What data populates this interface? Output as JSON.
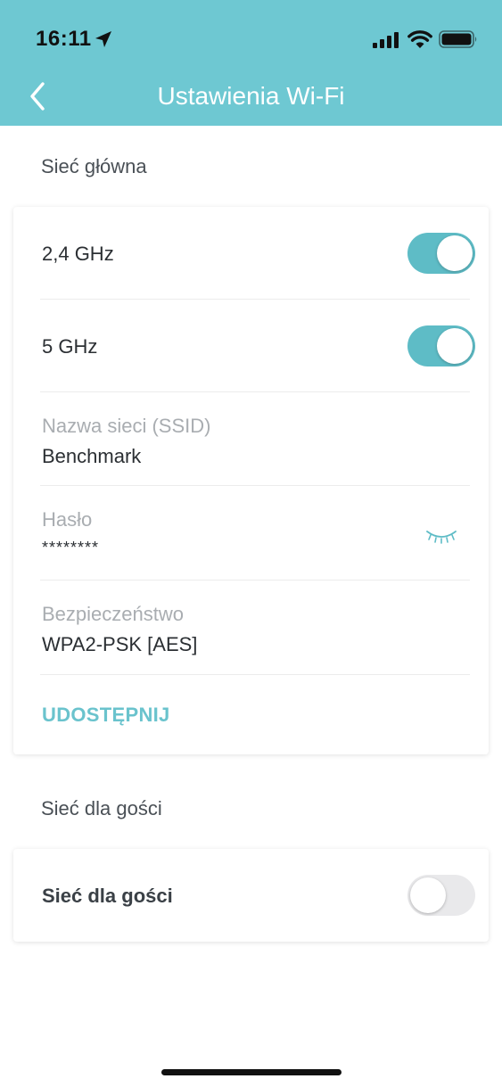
{
  "status_bar": {
    "time": "16:11"
  },
  "nav": {
    "title": "Ustawienia Wi-Fi",
    "back_icon": "chevron-left-icon"
  },
  "main_network": {
    "section_label": "Sieć główna",
    "band_24": {
      "label": "2,4 GHz",
      "enabled": true
    },
    "band_5": {
      "label": "5 GHz",
      "enabled": true
    },
    "ssid": {
      "caption": "Nazwa sieci (SSID)",
      "value": "Benchmark"
    },
    "password": {
      "caption": "Hasło",
      "value": "********",
      "reveal_icon": "eye-closed-icon"
    },
    "security": {
      "caption": "Bezpieczeństwo",
      "value": "WPA2-PSK [AES]"
    },
    "share_label": "UDOSTĘPNIJ"
  },
  "guest_network": {
    "section_label": "Sieć dla gości",
    "toggle": {
      "label": "Sieć dla gości",
      "enabled": false
    }
  },
  "colors": {
    "header": "#6ec8d2",
    "accent": "#5ebcc6",
    "toggle_off": "#e9e9eb"
  }
}
